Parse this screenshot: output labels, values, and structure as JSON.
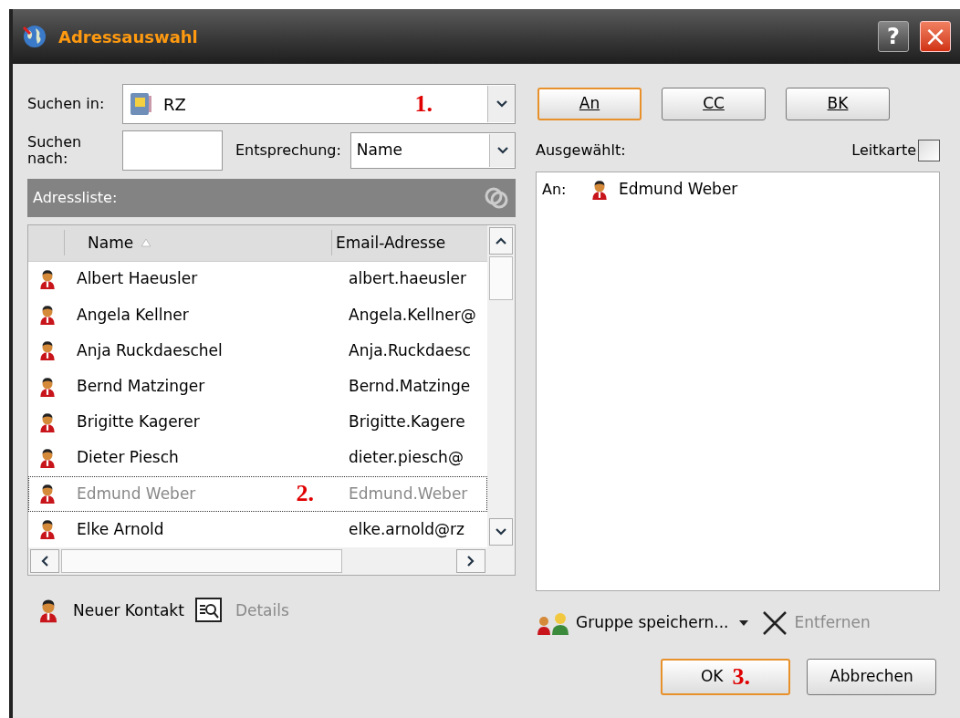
{
  "window": {
    "title": "Adressauswahl",
    "help": "?",
    "close": "×"
  },
  "search_in": {
    "label": "Suchen in:",
    "value": "RZ",
    "marker": "1."
  },
  "search_for": {
    "label": "Suchen nach:"
  },
  "match": {
    "label": "Entsprechung:",
    "value": "Name"
  },
  "address_list": {
    "title": "Adressliste:"
  },
  "table": {
    "columns": [
      "Name",
      "Email-Adresse"
    ],
    "rows": [
      {
        "name": "Albert Haeusler",
        "email": "albert.haeusler",
        "selected": false
      },
      {
        "name": "Angela Kellner",
        "email": "Angela.Kellner@",
        "selected": false
      },
      {
        "name": "Anja Ruckdaeschel",
        "email": "Anja.Ruckdaesc",
        "selected": false
      },
      {
        "name": "Bernd Matzinger",
        "email": "Bernd.Matzinge",
        "selected": false
      },
      {
        "name": "Brigitte Kagerer",
        "email": "Brigitte.Kagere",
        "selected": false
      },
      {
        "name": "Dieter Piesch",
        "email": "dieter.piesch@",
        "selected": false
      },
      {
        "name": "Edmund Weber",
        "email": "Edmund.Weber",
        "selected": true,
        "marker": "2."
      },
      {
        "name": "Elke Arnold",
        "email": "elke.arnold@rz",
        "selected": false
      }
    ]
  },
  "left_actions": [
    {
      "label": "Neuer Kontakt",
      "disabled": false
    },
    {
      "label": "Details",
      "disabled": true
    }
  ],
  "recipient_buttons": [
    {
      "label": "An",
      "selected": true
    },
    {
      "label": "CC",
      "selected": false
    },
    {
      "label": "BK",
      "selected": false
    }
  ],
  "selected_label": "Ausgewählt:",
  "leitkarte": {
    "label": "Leitkarte",
    "checked": false
  },
  "recipients": [
    {
      "type": "An:",
      "name": "Edmund Weber"
    }
  ],
  "right_actions": [
    {
      "label": "Gruppe speichern...",
      "disabled": false
    },
    {
      "label": "Entfernen",
      "disabled": true
    }
  ],
  "ok": {
    "label": "OK",
    "marker": "3."
  },
  "cancel": {
    "label": "Abbrechen"
  }
}
